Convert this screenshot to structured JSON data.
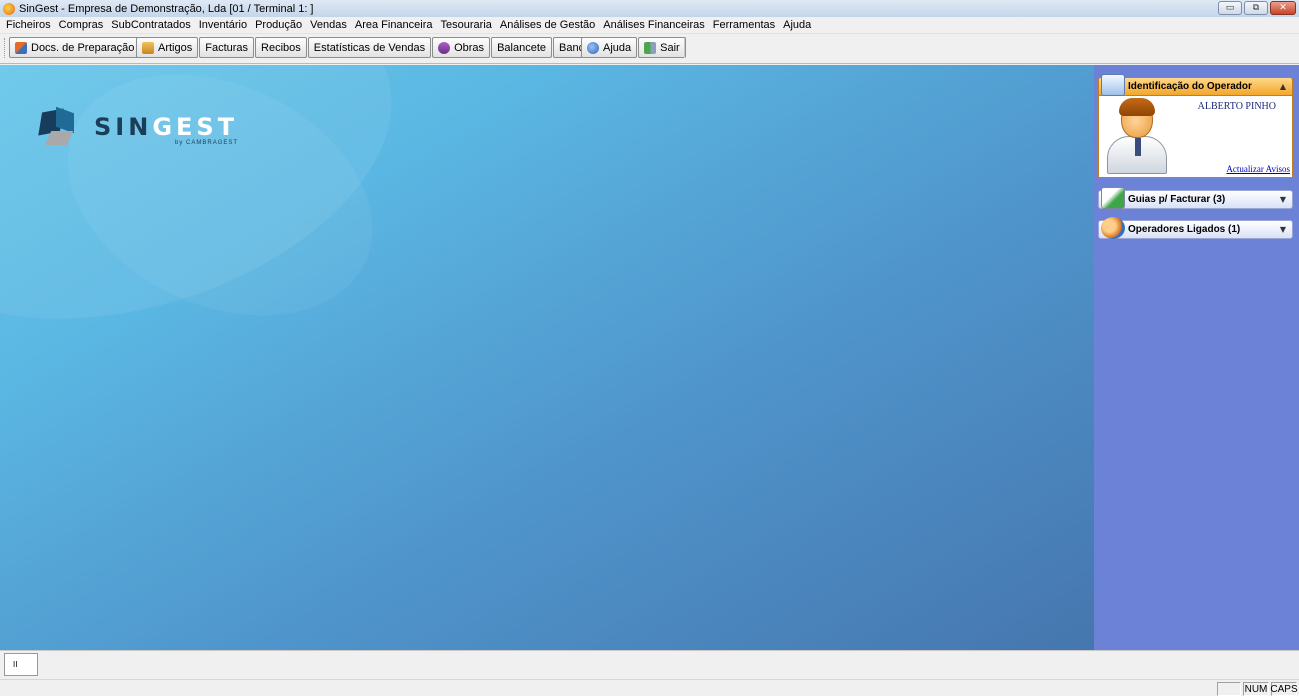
{
  "window": {
    "title": "SinGest - Empresa de Demonstração, Lda [01 / Terminal 1: ]",
    "minimize_glyph": "▭",
    "restore_glyph": "⧉",
    "close_glyph": "✕"
  },
  "menu": [
    "Ficheiros",
    "Compras",
    "SubContratados",
    "Inventário",
    "Produção",
    "Vendas",
    "Area Financeira",
    "Tesouraria",
    "Análises de Gestão",
    "Análises Financeiras",
    "Ferramentas",
    "Ajuda"
  ],
  "toolbar": {
    "docs_preparacao": "Docs. de Preparação",
    "artigos": "Artigos",
    "facturas": "Facturas",
    "recibos": "Recibos",
    "estatisticas": "Estatísticas de Vendas",
    "obras": "Obras",
    "balancete": "Balancete",
    "bancos": "Bancos",
    "ajuda": "Ajuda",
    "sair": "Sair"
  },
  "logo": {
    "name_dark": "SIN",
    "name_light": "GEST",
    "sub": "by CAMBRAGEST"
  },
  "panel": {
    "operator_title": "Identificação do Operador",
    "operator_name": "ALBERTO PINHO",
    "refresh_link": "Actualizar Avisos",
    "guias": "Guias p/ Facturar (3)",
    "operadores": "Operadores Ligados (1)",
    "collapse_glyph": "▲",
    "expand_glyph": "▼"
  },
  "taskbar": {
    "tab_label": "II"
  },
  "status": {
    "num": "NUM",
    "caps": "CAPS"
  },
  "colors": {
    "workspace": "#5bb8e3",
    "side_panel": "#6c82d6",
    "active_header": "#f3a62c"
  }
}
